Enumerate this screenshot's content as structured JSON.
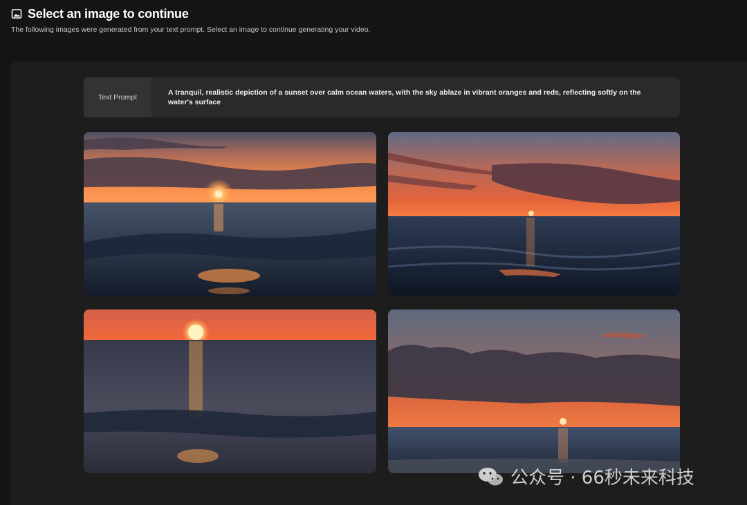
{
  "header": {
    "title": "Select an image to continue",
    "subtitle": "The following images were generated from your text prompt. Select an image to continue generating your video.",
    "icon": "image-icon"
  },
  "prompt": {
    "label": "Text Prompt",
    "text": "A tranquil, realistic depiction of a sunset over calm ocean waters, with the sky ablaze in vibrant oranges and reds, reflecting softly on the water's surface"
  },
  "images": [
    {
      "name": "sunset-image-1"
    },
    {
      "name": "sunset-image-2"
    },
    {
      "name": "sunset-image-3"
    },
    {
      "name": "sunset-image-4"
    }
  ],
  "watermark": {
    "text": "公众号 · 66秒未来科技",
    "icon": "wechat-icon"
  },
  "colors": {
    "background": "#141414",
    "panel": "#1d1d1d",
    "prompt_box": "#2a2a2a",
    "sunset_orange": "#e8743a",
    "sun": "#ffd27a"
  }
}
